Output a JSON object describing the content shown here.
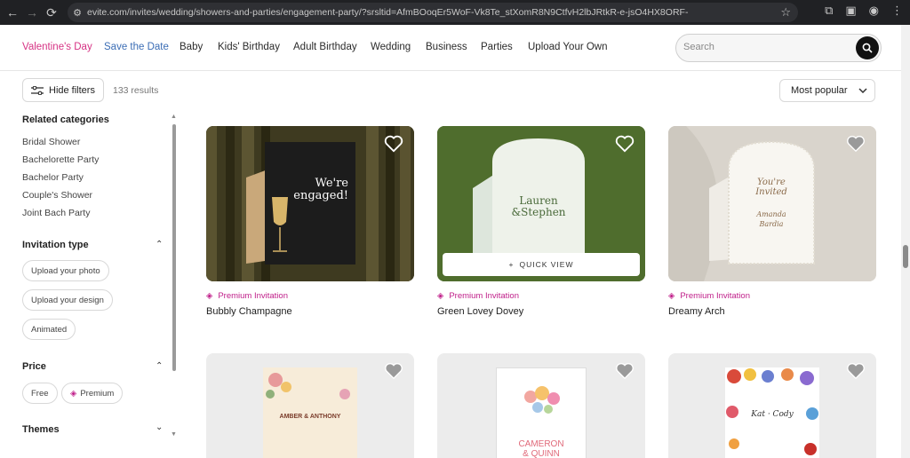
{
  "browser": {
    "url": "evite.com/invites/wedding/showers-and-parties/engagement-party/?srsltid=AfmBOoqEr5WoF-Vk8Te_stXomR8N9CtfvH2lbJRtkR-e-jsO4HX8ORF-"
  },
  "nav": {
    "items": [
      "Valentine's Day",
      "Save the Date",
      "Baby",
      "Kids' Birthday",
      "Adult Birthday",
      "Wedding",
      "Business",
      "Parties",
      "Upload Your Own"
    ],
    "search_placeholder": "Search",
    "accent_valentine": "#d63384",
    "accent_save": "#3b6db5"
  },
  "toolbar": {
    "hide_filters": "Hide filters",
    "results": "133 results",
    "sort": "Most popular"
  },
  "sidebar": {
    "related_title": "Related categories",
    "related": [
      "Bridal Shower",
      "Bachelorette Party",
      "Bachelor Party",
      "Couple's Shower",
      "Joint Bach Party"
    ],
    "invitation_type_title": "Invitation type",
    "invitation_types": [
      "Upload your photo",
      "Upload your design",
      "Animated"
    ],
    "price_title": "Price",
    "price_options": [
      "Free",
      "Premium"
    ],
    "themes_title": "Themes"
  },
  "products": [
    {
      "tag": "Premium Invitation",
      "name": "Bubbly Champagne",
      "card_lines": [
        "We're",
        "engaged!"
      ]
    },
    {
      "tag": "Premium Invitation",
      "name": "Green Lovey Dovey",
      "card_lines": [
        "Lauren",
        "&Stephen"
      ],
      "quick_view": "QUICK VIEW"
    },
    {
      "tag": "Premium Invitation",
      "name": "Dreamy Arch",
      "card_lines": [
        "You're",
        "Invited",
        "Amanda",
        "Bardia"
      ]
    },
    {
      "card_lines": [
        "AMBER & ANTHONY"
      ]
    },
    {
      "card_lines": [
        "CAMERON",
        "& QUINN"
      ]
    },
    {
      "card_lines": [
        "Kat · Cody"
      ]
    }
  ],
  "colors": {
    "premium": "#c0208a"
  }
}
